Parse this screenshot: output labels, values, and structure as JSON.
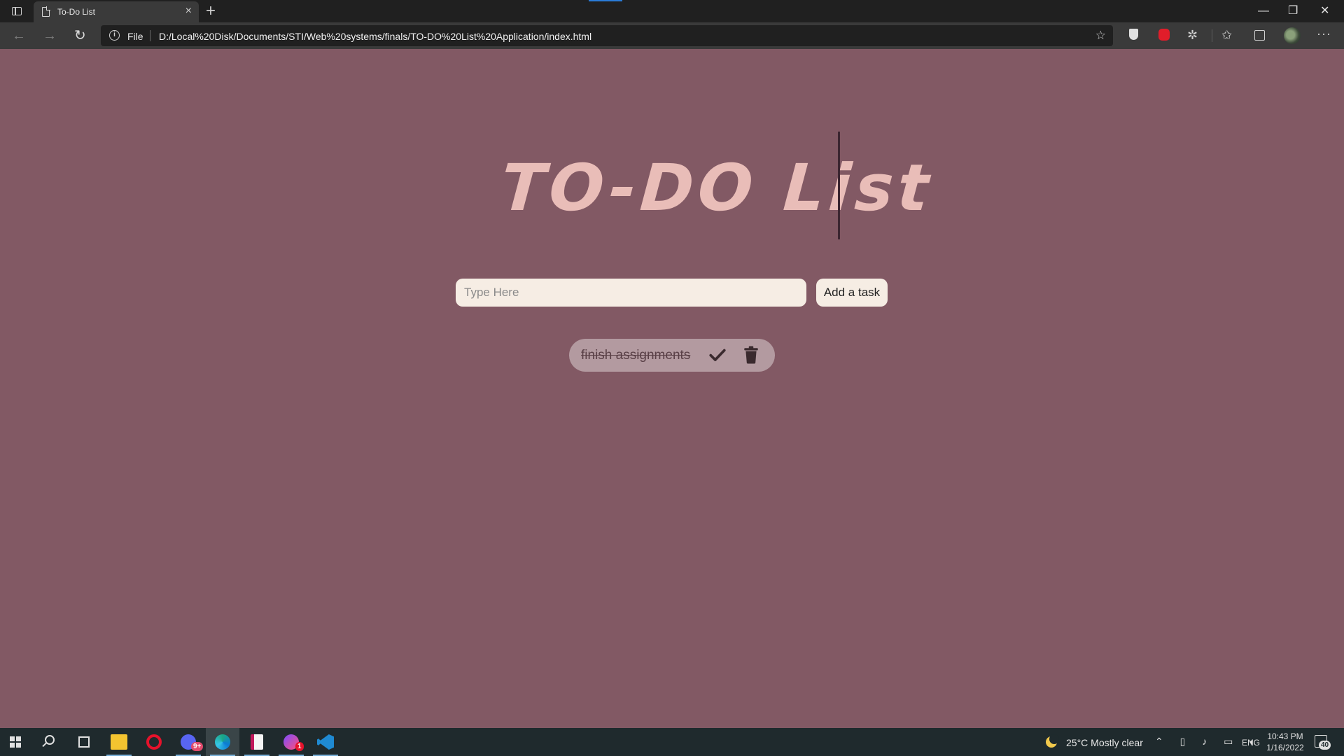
{
  "browser": {
    "tab_title": "To-Do List",
    "tab_close": "×",
    "new_tab": "+",
    "scheme_label": "File",
    "url": "D:/Local%20Disk/Documents/STI/Web%20systems/finals/TO-DO%20List%20Application/index.html",
    "window_minimize": "—",
    "window_restore": "❐",
    "window_close": "✕",
    "more_menu": "···"
  },
  "app": {
    "heading": "TO-DO List",
    "input_placeholder": "Type Here",
    "add_button_label": "Add a task",
    "tasks": [
      {
        "text": "finish assignments",
        "completed": true
      }
    ],
    "colors": {
      "background": "#825964",
      "heading": "#e9bdb8",
      "input_bg": "#f6ede4",
      "task_bg": "#b39aa0"
    }
  },
  "taskbar": {
    "weather": "25°C  Mostly clear",
    "language": "ENG",
    "time": "10:43 PM",
    "date": "1/16/2022",
    "notification_count": "40",
    "discord_badge": "9+",
    "messenger_badge": "1",
    "apps": [
      "start-icon",
      "search-icon",
      "task-view-icon",
      "file-explorer-icon",
      "opera-icon",
      "discord-icon",
      "edge-icon",
      "notes-icon",
      "messenger-icon",
      "vscode-icon"
    ]
  }
}
